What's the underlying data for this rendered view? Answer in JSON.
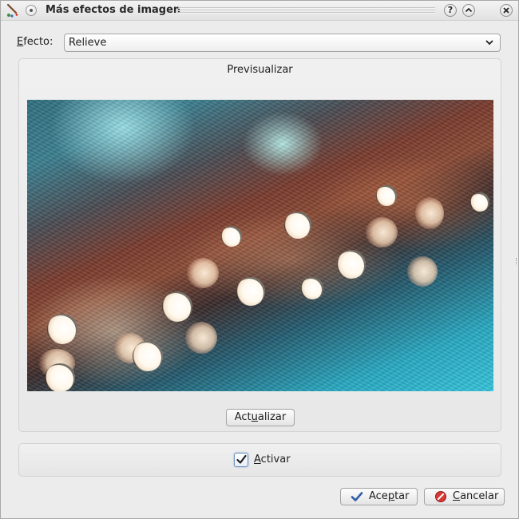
{
  "window": {
    "title": "Más efectos de imagen",
    "help_glyph": "?",
    "shade_glyph": "^",
    "close_glyph": "×"
  },
  "effect": {
    "label_prefix": "E",
    "label_rest": "fecto:",
    "selected": "Relieve"
  },
  "preview": {
    "title": "Previsualizar",
    "update_pre": "Act",
    "update_key": "u",
    "update_post": "alizar"
  },
  "activate": {
    "label_prefix": "A",
    "label_rest": "ctivar",
    "checked": true
  },
  "buttons": {
    "ok_pre": "Ace",
    "ok_key": "p",
    "ok_post": "tar",
    "cancel_key": "C",
    "cancel_rest": "ancelar"
  },
  "colors": {
    "check_accent": "#3b6ea5",
    "ok_icon": "#2f5fa8",
    "cancel_icon": "#c0272d"
  }
}
